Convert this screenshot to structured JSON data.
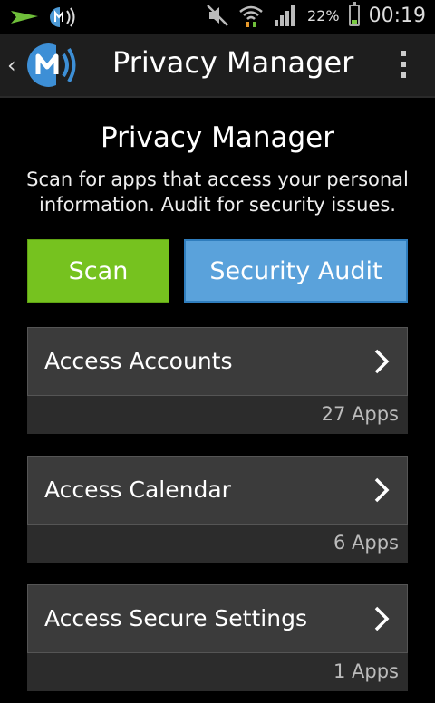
{
  "status_bar": {
    "battery_percent": "22%",
    "time": "00:19",
    "icons": [
      "send-icon",
      "malwarebytes-notification-icon",
      "mute-icon",
      "wifi-icon",
      "signal-icon",
      "battery-icon"
    ]
  },
  "action_bar": {
    "title": "Privacy Manager"
  },
  "main": {
    "title": "Privacy Manager",
    "description": "Scan for apps that access your personal information. Audit for security issues.",
    "scan_button": "Scan",
    "audit_button": "Security Audit"
  },
  "categories": [
    {
      "label": "Access Accounts",
      "count": "27 Apps"
    },
    {
      "label": "Access Calendar",
      "count": "6 Apps"
    },
    {
      "label": "Access Secure Settings",
      "count": "1 Apps"
    }
  ],
  "colors": {
    "scan_green": "#76c21f",
    "audit_blue": "#5aa2db",
    "card_bg": "#3b3b3b"
  }
}
